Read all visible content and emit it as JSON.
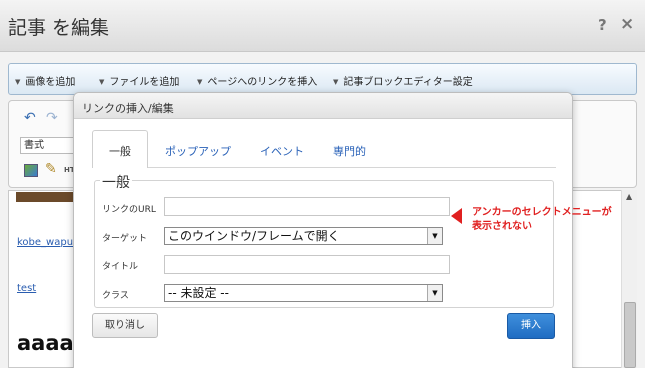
{
  "window": {
    "title": "記事 を編集",
    "help_label": "?",
    "close_label": "×"
  },
  "menubar": {
    "items": [
      {
        "label": "画像を追加"
      },
      {
        "label": "ファイルを追加"
      },
      {
        "label": "ページへのリンクを挿入"
      },
      {
        "label": "記事ブロックエディター設定"
      }
    ]
  },
  "editor": {
    "format_select": "書式",
    "ht_label": "HT",
    "content": {
      "link1": "kobe_wapu",
      "link2": "test",
      "big_text": "aaaa"
    }
  },
  "dialog": {
    "title": "リンクの挿入/編集",
    "tabs": [
      {
        "label": "一般",
        "active": true
      },
      {
        "label": "ポップアップ"
      },
      {
        "label": "イベント"
      },
      {
        "label": "専門的"
      }
    ],
    "legend": "一般",
    "fields": {
      "url_label": "リンクのURL",
      "url_value": "",
      "target_label": "ターゲット",
      "target_value": "このウインドウ/フレームで開く",
      "title_label": "タイトル",
      "title_value": "",
      "class_label": "クラス",
      "class_value": "-- 未設定 --"
    },
    "cancel_label": "取り消し",
    "insert_label": "挿入"
  },
  "annotation": {
    "line1": "アンカーのセレクトメニューが",
    "line2": "表示されない",
    "color": "#e02020"
  },
  "colors": {
    "accent": "#1f6cc2",
    "link": "#2a5db0"
  }
}
